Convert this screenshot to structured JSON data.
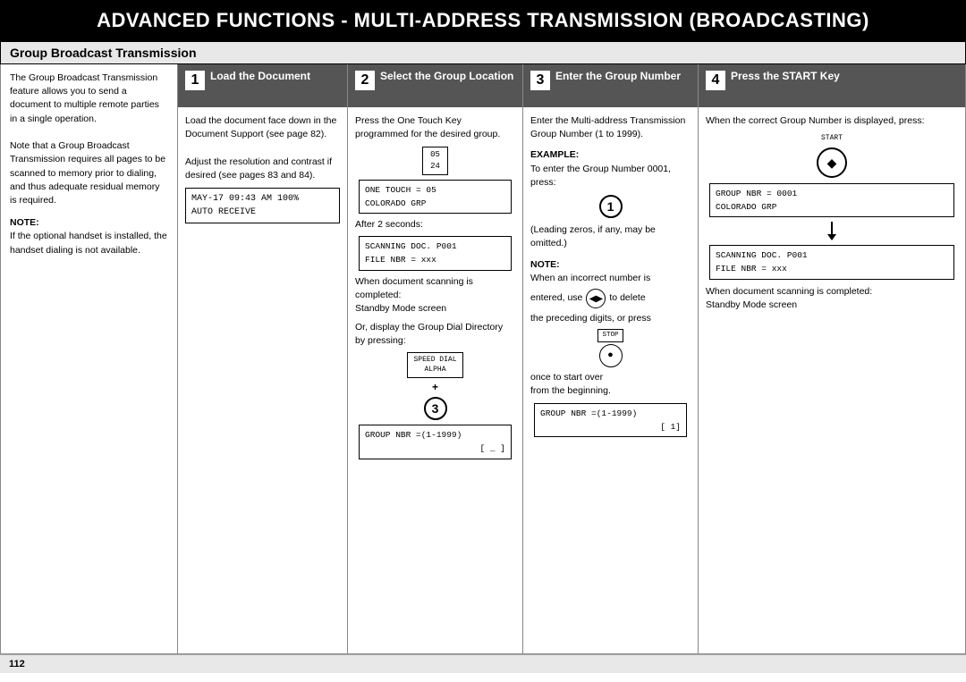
{
  "header": {
    "title": "ADVANCED FUNCTIONS - MULTI-ADDRESS TRANSMISSION (BROADCASTING)"
  },
  "section_title": "Group Broadcast Transmission",
  "left_panel": {
    "intro": "The Group Broadcast Transmission feature allows you to send a document to multiple remote parties in a single operation.",
    "note_label": "NOTE:",
    "note_text": "If the optional handset is installed, the handset dialing is not available.",
    "extra": "Note that a Group Broadcast Transmission requires all pages to be scanned to memory prior to dialing, and thus adequate residual memory is required."
  },
  "steps": [
    {
      "number": "1",
      "title": "Load the Document",
      "body_paragraphs": [
        "Load the document face down in the Document Support (see page 82).",
        "Adjust the resolution and contrast if desired (see pages 83 and 84)."
      ],
      "lcd": {
        "line1": "MAY-17 09:43 AM 100%",
        "line2": "     AUTO RECEIVE"
      }
    },
    {
      "number": "2",
      "title": "Select  the Group Location",
      "body_paragraphs": [
        "Press the One Touch Key programmed for the desired group."
      ],
      "after_2sec": "After 2 seconds:",
      "lcd1_line1": "ONE TOUCH =      05",
      "lcd1_line2": "COLORADO GRP",
      "lcd2_line1": "SCANNING DOC.   P001",
      "lcd2_line2": "FILE NBR =       xxx",
      "when_complete": "When document scanning is completed:",
      "standby": "Standby Mode screen",
      "or_display": "Or, display the Group Dial Directory by pressing:",
      "speed_dial_label": "SPEED DIAL",
      "alpha_label": "ALPHA",
      "plus": "+",
      "group_nbr_label": "GROUP NBR =(1-1999)",
      "group_nbr_cursor": "[ _ ]",
      "small_display_05_top": "05",
      "small_display_05_bottom": "24"
    },
    {
      "number": "3",
      "title": "Enter the Group Number",
      "body_intro": "Enter the Multi-address Transmission Group Number (1 to 1999).",
      "example_label": "EXAMPLE:",
      "example_text": "To enter the Group Number 0001, press:",
      "leading_zeros": "(Leading zeros, if any, may be omitted.)",
      "note_label": "NOTE:",
      "note_text": "When an incorrect number is",
      "note_text2": "entered, use",
      "note_text3": "to delete",
      "note_text4": "the preceding digits, or press",
      "stop_label": "STOP",
      "note_text5": "once to start over",
      "note_text6": "from the beginning.",
      "lcd_line1": "GROUP NBR =(1-1999)",
      "lcd_line2": "[ 1]"
    },
    {
      "number": "4",
      "title": "Press the START Key",
      "body_intro": "When the correct Group Number is displayed, press:",
      "start_label": "START",
      "lcd1_line1": "GROUP NBR =      0001",
      "lcd1_line2": "COLORADO GRP",
      "lcd2_line1": "SCANNING DOC.   P001",
      "lcd2_line2": "FILE NBR =       xxx",
      "when_complete": "When document scanning is completed:",
      "standby": "Standby Mode screen"
    }
  ],
  "page_number": "112"
}
